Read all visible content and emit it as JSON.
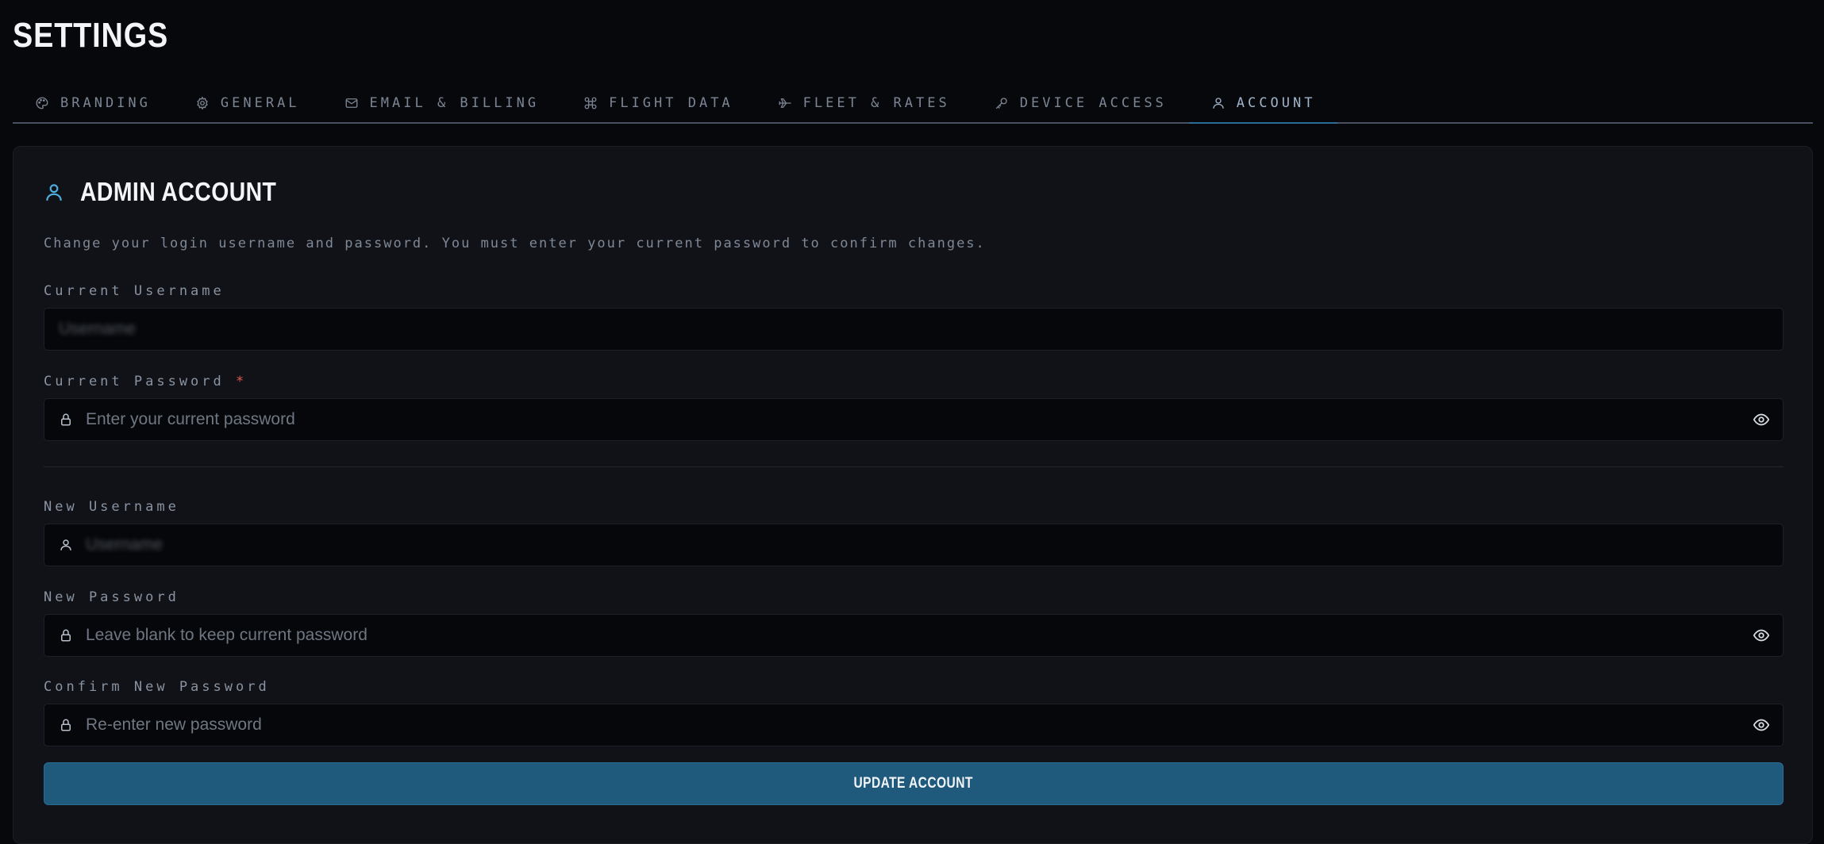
{
  "page": {
    "title": "SETTINGS"
  },
  "tabs": [
    {
      "label": "BRANDING",
      "icon": "palette-icon"
    },
    {
      "label": "GENERAL",
      "icon": "gear-icon"
    },
    {
      "label": "EMAIL & BILLING",
      "icon": "mail-icon"
    },
    {
      "label": "FLIGHT DATA",
      "icon": "drone-icon"
    },
    {
      "label": "FLEET & RATES",
      "icon": "plane-icon"
    },
    {
      "label": "DEVICE ACCESS",
      "icon": "key-icon"
    },
    {
      "label": "ACCOUNT",
      "icon": "user-icon",
      "active": true
    }
  ],
  "panel": {
    "title": "ADMIN ACCOUNT",
    "description": "Change your login username and password. You must enter your current password to confirm changes."
  },
  "fields": {
    "current_username": {
      "label": "Current Username",
      "value": "Username"
    },
    "current_password": {
      "label": "Current Password",
      "required_mark": "*",
      "placeholder": "Enter your current password"
    },
    "new_username": {
      "label": "New Username",
      "value": "Username"
    },
    "new_password": {
      "label": "New Password",
      "placeholder": "Leave blank to keep current password"
    },
    "confirm_password": {
      "label": "Confirm New Password",
      "placeholder": "Re-enter new password"
    }
  },
  "actions": {
    "update_label": "UPDATE ACCOUNT"
  },
  "colors": {
    "background": "#07080b",
    "panel": "#101217",
    "accent": "#1f5a7c",
    "accent_icon": "#4fb0e0",
    "required": "#e05a4f"
  }
}
